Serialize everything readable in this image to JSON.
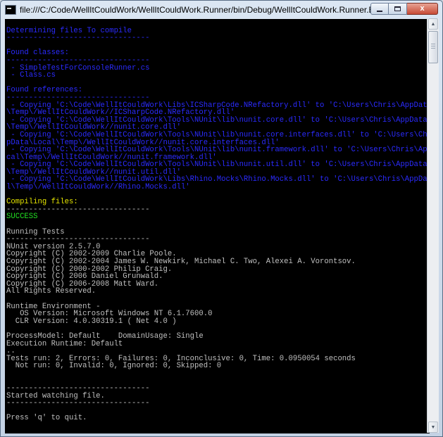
{
  "window": {
    "title": "file:///C:/Code/WellItCouldWork/WellItCouldWork.Runner/bin/Debug/WellItCouldWork.Runner.EXE",
    "controls": {
      "minimize": "minimize",
      "maximize": "maximize",
      "close": "x"
    }
  },
  "colors": {
    "blue": "#2b2bff",
    "yellow": "#e6e600",
    "green": "#22e022",
    "gray": "#c0c0c0"
  },
  "console_lines": [
    {
      "text": "",
      "color": "gray"
    },
    {
      "text": "Determining files To compile",
      "color": "blue"
    },
    {
      "text": "--------------------------------",
      "color": "blue"
    },
    {
      "text": "",
      "color": "gray"
    },
    {
      "text": "Found classes:",
      "color": "blue"
    },
    {
      "text": "--------------------------------",
      "color": "blue"
    },
    {
      "text": " - SimpleTestForConsoleRunner.cs",
      "color": "blue"
    },
    {
      "text": " - Class.cs",
      "color": "blue"
    },
    {
      "text": "",
      "color": "gray"
    },
    {
      "text": "Found references:",
      "color": "blue"
    },
    {
      "text": "--------------------------------",
      "color": "blue"
    },
    {
      "text": " - Copying 'C:\\Code\\WellItCouldWork\\Libs\\ICSharpCode.NRefactory.dll' to 'C:\\Users\\Chris\\AppData\\Local",
      "color": "blue"
    },
    {
      "text": "\\Temp\\/WellItCouldWork//ICSharpCode.NRefactory.dll'",
      "color": "blue"
    },
    {
      "text": " - Copying 'C:\\Code\\WellItCouldWork\\Tools\\NUnit\\lib\\nunit.core.dll' to 'C:\\Users\\Chris\\AppData\\Local",
      "color": "blue"
    },
    {
      "text": "\\Temp\\/WellItCouldWork//nunit.core.dll'",
      "color": "blue"
    },
    {
      "text": " - Copying 'C:\\Code\\WellItCouldWork\\Tools\\NUnit\\lib\\nunit.core.interfaces.dll' to 'C:\\Users\\Chris\\Ap",
      "color": "blue"
    },
    {
      "text": "pData\\Local\\Temp\\/WellItCouldWork//nunit.core.interfaces.dll'",
      "color": "blue"
    },
    {
      "text": " - Copying 'C:\\Code\\WellItCouldWork\\Tools\\NUnit\\lib\\nunit.framework.dll' to 'C:\\Users\\Chris\\AppData\\Lo",
      "color": "blue"
    },
    {
      "text": "cal\\Temp\\/WellItCouldWork//nunit.framework.dll'",
      "color": "blue"
    },
    {
      "text": " - Copying 'C:\\Code\\WellItCouldWork\\Tools\\NUnit\\lib\\nunit.util.dll' to 'C:\\Users\\Chris\\AppData\\Local",
      "color": "blue"
    },
    {
      "text": "\\Temp\\/WellItCouldWork//nunit.util.dll'",
      "color": "blue"
    },
    {
      "text": " - Copying 'C:\\Code\\WellItCouldWork\\Libs\\Rhino.Mocks\\Rhino.Mocks.dll' to 'C:\\Users\\Chris\\AppData\\Loca",
      "color": "blue"
    },
    {
      "text": "l\\Temp\\/WellItCouldWork//Rhino.Mocks.dll'",
      "color": "blue"
    },
    {
      "text": "",
      "color": "gray"
    },
    {
      "text": "Compiling files:",
      "color": "yellow"
    },
    {
      "text": "--------------------------------",
      "color": "gray"
    },
    {
      "text": "SUCCESS",
      "color": "green"
    },
    {
      "text": "",
      "color": "gray"
    },
    {
      "text": "Running Tests",
      "color": "gray"
    },
    {
      "text": "--------------------------------",
      "color": "gray"
    },
    {
      "text": "NUnit version 2.5.7.0",
      "color": "gray"
    },
    {
      "text": "Copyright (C) 2002-2009 Charlie Poole.",
      "color": "gray"
    },
    {
      "text": "Copyright (C) 2002-2004 James W. Newkirk, Michael C. Two, Alexei A. Vorontsov.",
      "color": "gray"
    },
    {
      "text": "Copyright (C) 2000-2002 Philip Craig.",
      "color": "gray"
    },
    {
      "text": "Copyright (C) 2006 Daniel Grunwald.",
      "color": "gray"
    },
    {
      "text": "Copyright (C) 2006-2008 Matt Ward.",
      "color": "gray"
    },
    {
      "text": "All Rights Reserved.",
      "color": "gray"
    },
    {
      "text": "",
      "color": "gray"
    },
    {
      "text": "Runtime Environment -",
      "color": "gray"
    },
    {
      "text": "   OS Version: Microsoft Windows NT 6.1.7600.0",
      "color": "gray"
    },
    {
      "text": "  CLR Version: 4.0.30319.1 ( Net 4.0 )",
      "color": "gray"
    },
    {
      "text": "",
      "color": "gray"
    },
    {
      "text": "ProcessModel: Default    DomainUsage: Single",
      "color": "gray"
    },
    {
      "text": "Execution Runtime: Default",
      "color": "gray"
    },
    {
      "text": "..",
      "color": "gray"
    },
    {
      "text": "Tests run: 2, Errors: 0, Failures: 0, Inconclusive: 0, Time: 0.0950054 seconds",
      "color": "gray"
    },
    {
      "text": "  Not run: 0, Invalid: 0, Ignored: 0, Skipped: 0",
      "color": "gray"
    },
    {
      "text": "",
      "color": "gray"
    },
    {
      "text": "",
      "color": "gray"
    },
    {
      "text": "--------------------------------",
      "color": "gray"
    },
    {
      "text": "Started watching file.",
      "color": "gray"
    },
    {
      "text": "--------------------------------",
      "color": "gray"
    },
    {
      "text": "",
      "color": "gray"
    },
    {
      "text": "Press 'q' to quit.",
      "color": "gray"
    }
  ],
  "scrollbar": {
    "up_icon": "arrow-up-icon",
    "down_icon": "arrow-down-icon"
  }
}
